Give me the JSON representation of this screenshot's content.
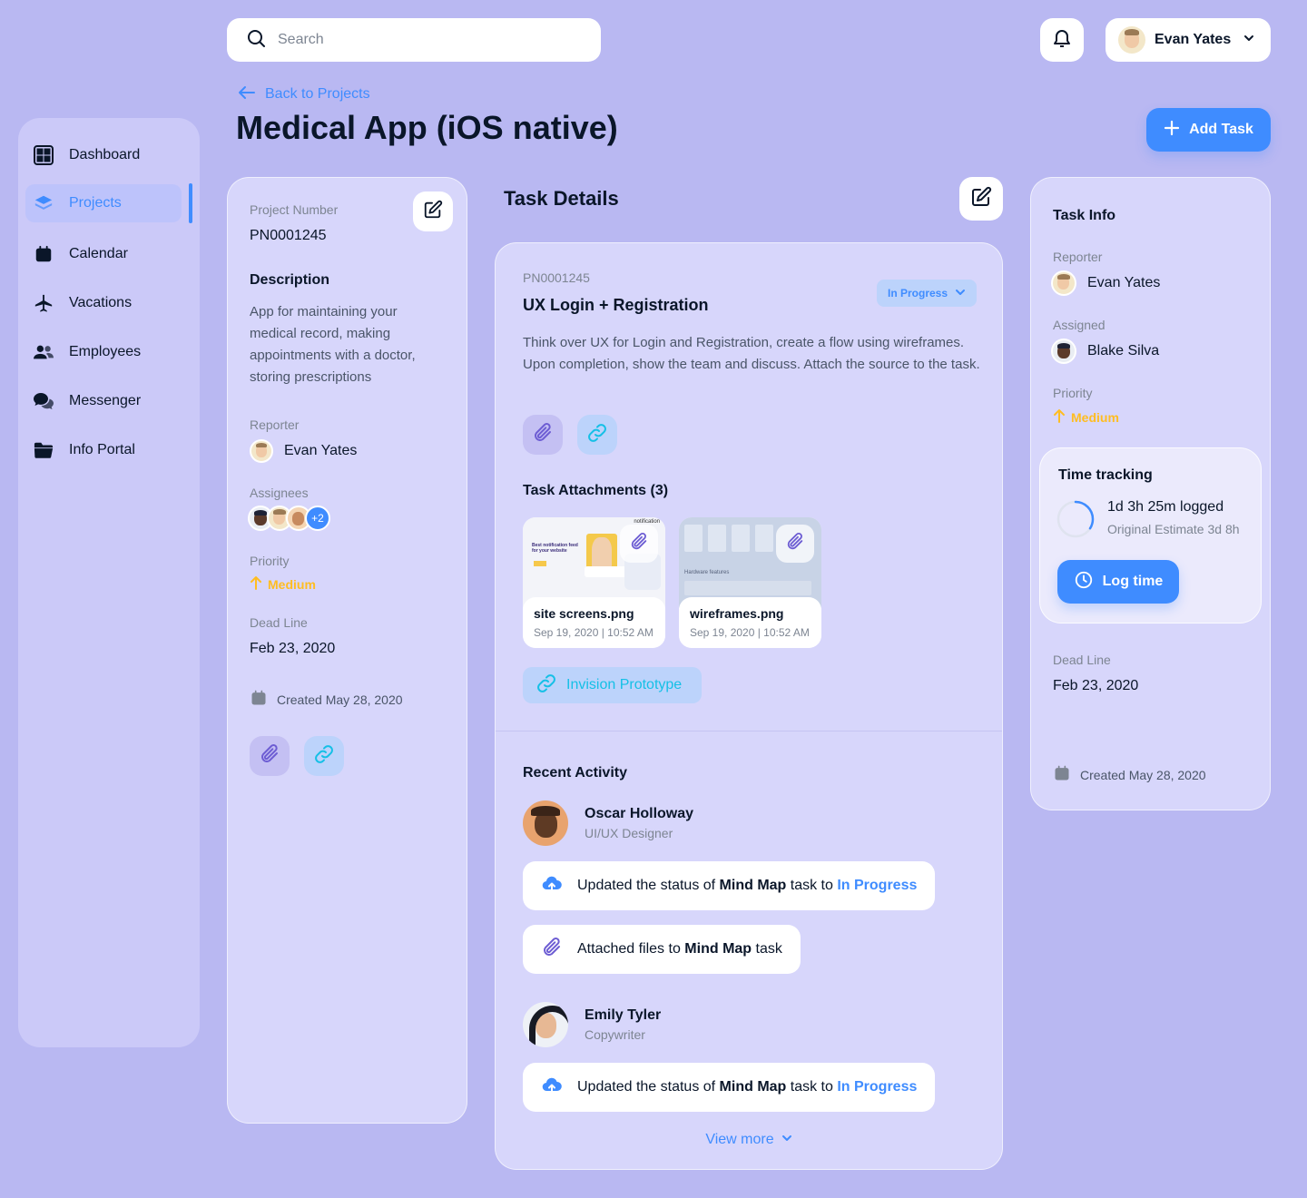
{
  "search": {
    "placeholder": "Search"
  },
  "user_menu": {
    "name": "Evan Yates"
  },
  "sidebar": {
    "items": [
      {
        "label": "Dashboard",
        "icon": "dashboard-icon"
      },
      {
        "label": "Projects",
        "icon": "layers-icon",
        "active": true
      },
      {
        "label": "Calendar",
        "icon": "calendar-icon"
      },
      {
        "label": "Vacations",
        "icon": "airplane-icon"
      },
      {
        "label": "Employees",
        "icon": "people-icon"
      },
      {
        "label": "Messenger",
        "icon": "chat-icon"
      },
      {
        "label": "Info Portal",
        "icon": "folder-icon"
      }
    ]
  },
  "header": {
    "back_label": "Back to Projects",
    "title": "Medical App (iOS native)",
    "add_task_label": "Add Task"
  },
  "project": {
    "number_label": "Project Number",
    "number": "PN0001245",
    "description_heading": "Description",
    "description": "App for maintaining your medical record, making appointments with a doctor, storing prescriptions",
    "reporter_label": "Reporter",
    "reporter": "Evan Yates",
    "assignees_label": "Assignees",
    "assignees_more": "+2",
    "priority_label": "Priority",
    "priority": "Medium",
    "deadline_label": "Dead Line",
    "deadline": "Feb 23, 2020",
    "created": "Created May 28, 2020"
  },
  "task": {
    "section_title": "Task Details",
    "id": "PN0001245",
    "title": "UX Login + Registration",
    "status": "In Progress",
    "description": "Think over UX for Login and Registration, create a flow using wireframes. Upon completion, show the team and discuss. Attach the source to the task.",
    "attachments_heading": "Task Attachments (3)",
    "attachments": [
      {
        "name": "site screens.png",
        "date": "Sep 19, 2020 | 10:52 AM"
      },
      {
        "name": "wireframes.png",
        "date": "Sep 19, 2020 | 10:52 AM"
      }
    ],
    "link_label": "Invision Prototype",
    "thumb_text_1": "Best notification feed for your website",
    "thumb_text_2": "Hardware features",
    "thumb_text_3": "notification"
  },
  "activity": {
    "heading": "Recent Activity",
    "users": [
      {
        "name": "Oscar Holloway",
        "role": "UI/UX Designer",
        "entries": [
          {
            "prefix": "Updated the status of ",
            "bold": "Mind Map",
            "middle": " task to ",
            "highlight": "In Progress",
            "icon": "cloud-upload-icon"
          },
          {
            "prefix": "Attached files to ",
            "bold": "Mind Map",
            "middle": " task",
            "highlight": "",
            "icon": "paperclip-icon"
          }
        ]
      },
      {
        "name": "Emily Tyler",
        "role": "Copywriter",
        "entries": [
          {
            "prefix": "Updated the status of ",
            "bold": "Mind Map",
            "middle": " task to ",
            "highlight": "In Progress",
            "icon": "cloud-upload-icon"
          }
        ]
      }
    ],
    "view_more": "View more"
  },
  "task_info": {
    "heading": "Task Info",
    "reporter_label": "Reporter",
    "reporter": "Evan Yates",
    "assigned_label": "Assigned",
    "assigned": "Blake Silva",
    "priority_label": "Priority",
    "priority": "Medium",
    "time_tracking_heading": "Time tracking",
    "logged": "1d 3h 25m logged",
    "estimate": "Original Estimate 3d 8h",
    "logged_fraction": 0.34,
    "log_button": "Log time",
    "deadline_label": "Dead Line",
    "deadline": "Feb 23, 2020",
    "created": "Created May 28, 2020"
  },
  "colors": {
    "accent": "#3f8cff",
    "priority": "#ffbd21",
    "background": "#b9b8f2"
  }
}
